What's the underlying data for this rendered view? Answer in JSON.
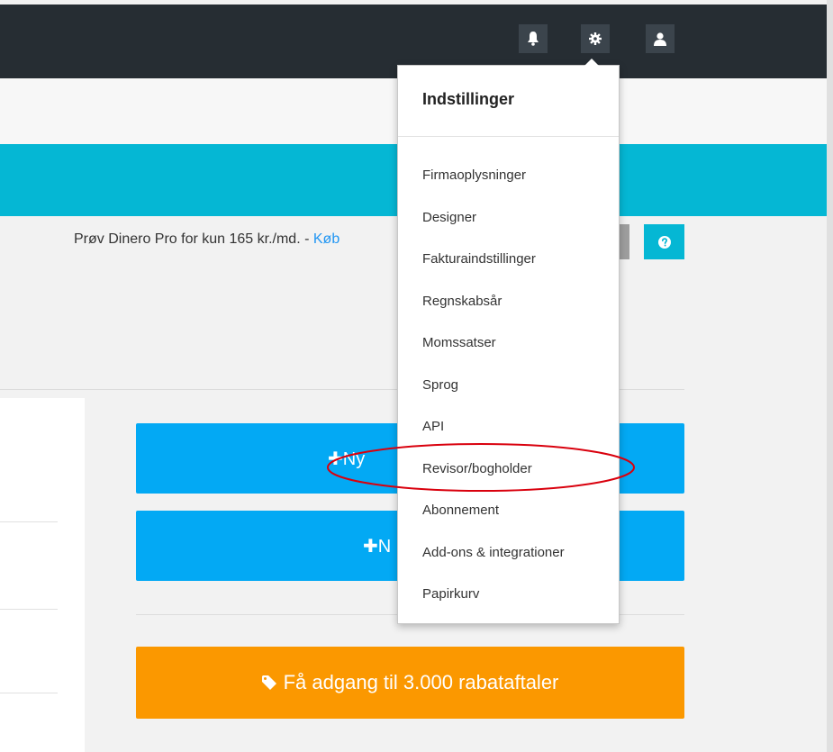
{
  "header": {
    "icons": [
      "bell-icon",
      "gear-icon",
      "user-icon"
    ]
  },
  "promo": {
    "text": "Prøv Dinero Pro for kun 165 kr./md. - ",
    "link": "Køb"
  },
  "buttons": {
    "new_primary": "Ny",
    "new_secondary": "N",
    "deals": "Få adgang til 3.000 rabataftaler"
  },
  "settings_menu": {
    "title": "Indstillinger",
    "items": [
      {
        "label": "Firmaoplysninger"
      },
      {
        "label": "Designer"
      },
      {
        "label": "Fakturaindstillinger"
      },
      {
        "label": "Regnskabsår"
      },
      {
        "label": "Momssatser"
      },
      {
        "label": "Sprog"
      },
      {
        "label": "API"
      },
      {
        "label": "Revisor/bogholder"
      },
      {
        "label": "Abonnement"
      },
      {
        "label": "Add-ons & integrationer"
      },
      {
        "label": "Papirkurv"
      }
    ],
    "highlighted_item": "Revisor/bogholder"
  },
  "colors": {
    "topbar": "#262d33",
    "teal": "#05b7d4",
    "blue": "#03a9f4",
    "orange": "#fb9800",
    "highlight_ellipse": "#d9000d"
  }
}
